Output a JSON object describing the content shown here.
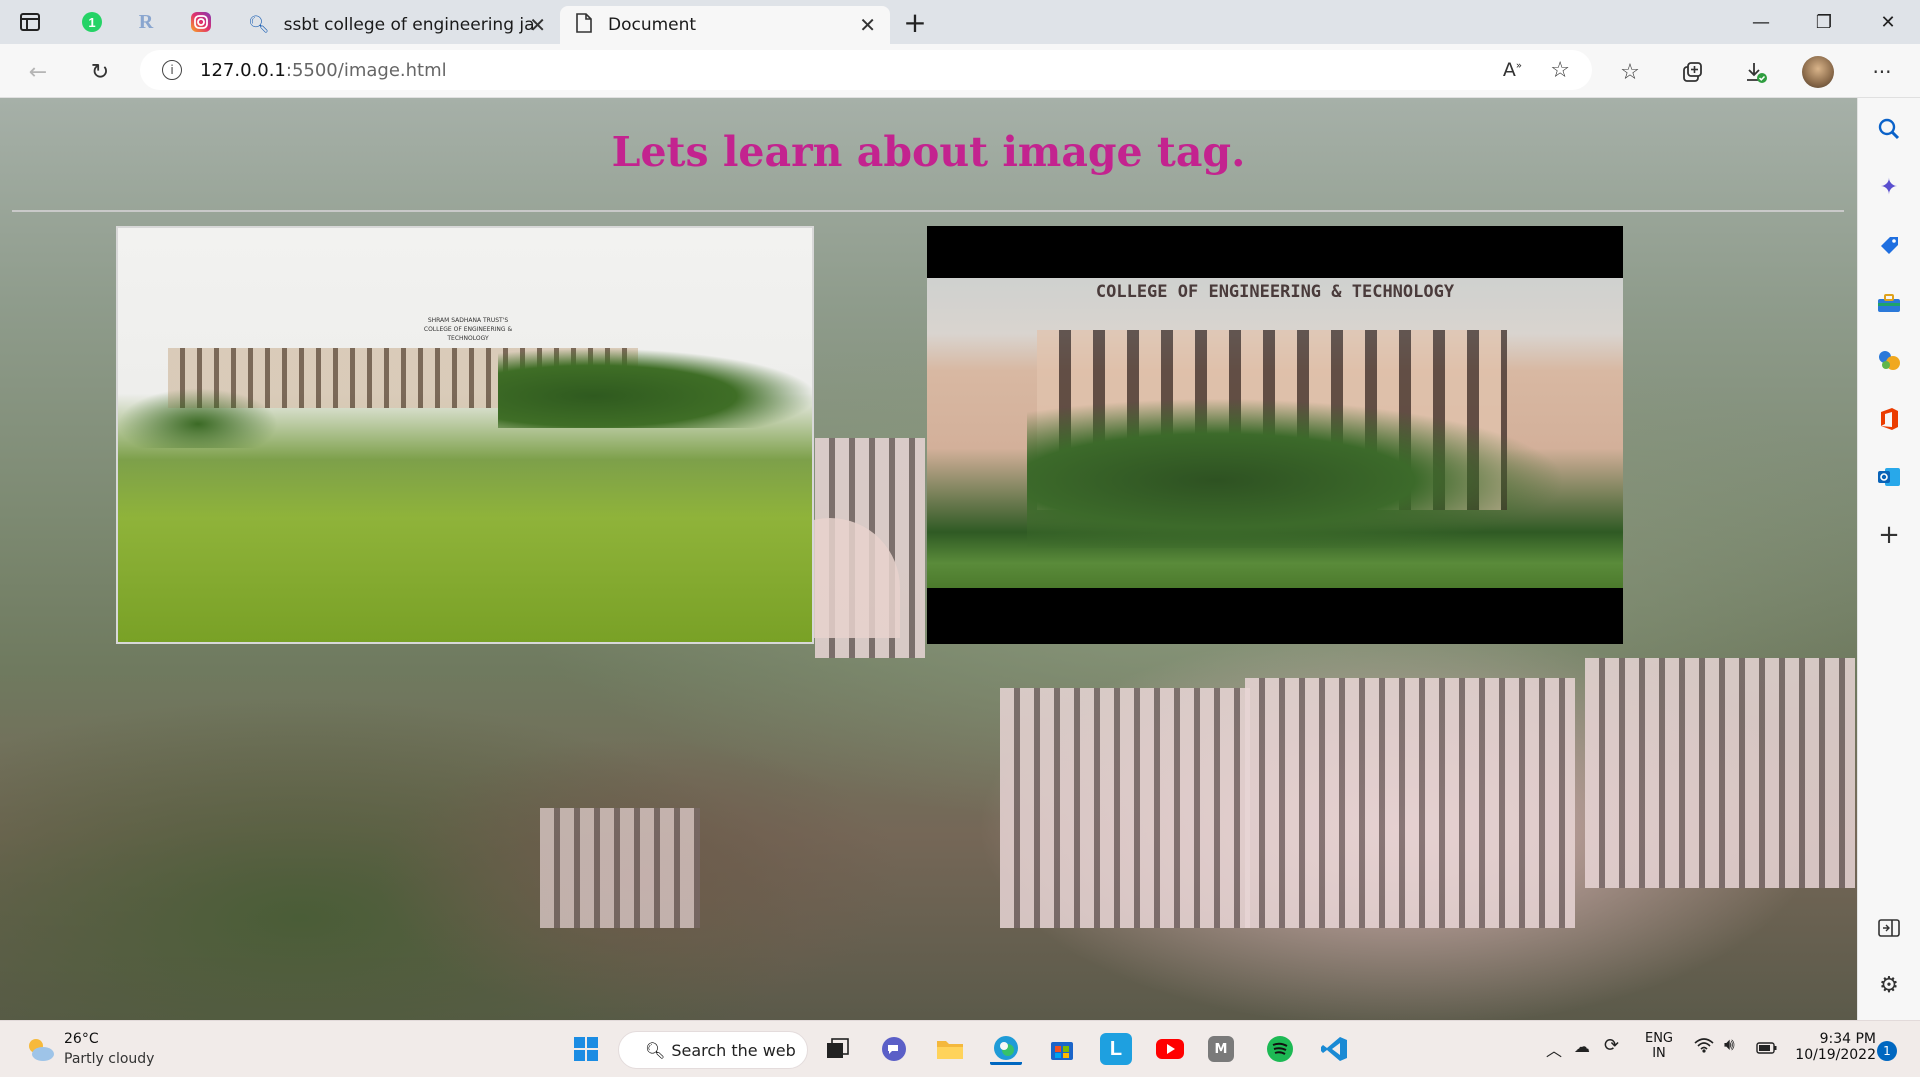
{
  "browser": {
    "tabs": [
      {
        "title": "ssbt college of engineering jalga",
        "active": false
      },
      {
        "title": "Document",
        "active": true
      }
    ],
    "pinned_icons": [
      "tab-actions-icon",
      "whatsapp-icon",
      "r-icon",
      "instagram-icon"
    ],
    "url_host": "127.0.0.1",
    "url_rest": ":5500/image.html",
    "window_controls": {
      "minimize": "—",
      "restore": "❐",
      "close": "✕"
    }
  },
  "page": {
    "heading": "Lets learn about image tag.",
    "image2_banner": "COLLEGE OF ENGINEERING & TECHNOLOGY",
    "image1_banner_line1": "SHRAM SADHANA TRUST'S",
    "image1_banner_line2": "COLLEGE OF ENGINEERING & TECHNOLOGY"
  },
  "sidebar": {
    "icons": [
      "search-icon",
      "copilot-icon",
      "shopping-icon",
      "tools-icon",
      "games-icon",
      "office-icon",
      "outlook-icon",
      "add-icon",
      "split-screen-icon",
      "settings-icon"
    ]
  },
  "taskbar": {
    "weather_temp": "26°C",
    "weather_desc": "Partly cloudy",
    "search_label": "Search the web",
    "lang_top": "ENG",
    "lang_bottom": "IN",
    "time": "9:34 PM",
    "date": "10/19/2022",
    "notification_count": "1",
    "colors": {
      "accent": "#0067c0",
      "heading": "#c3238f"
    }
  }
}
